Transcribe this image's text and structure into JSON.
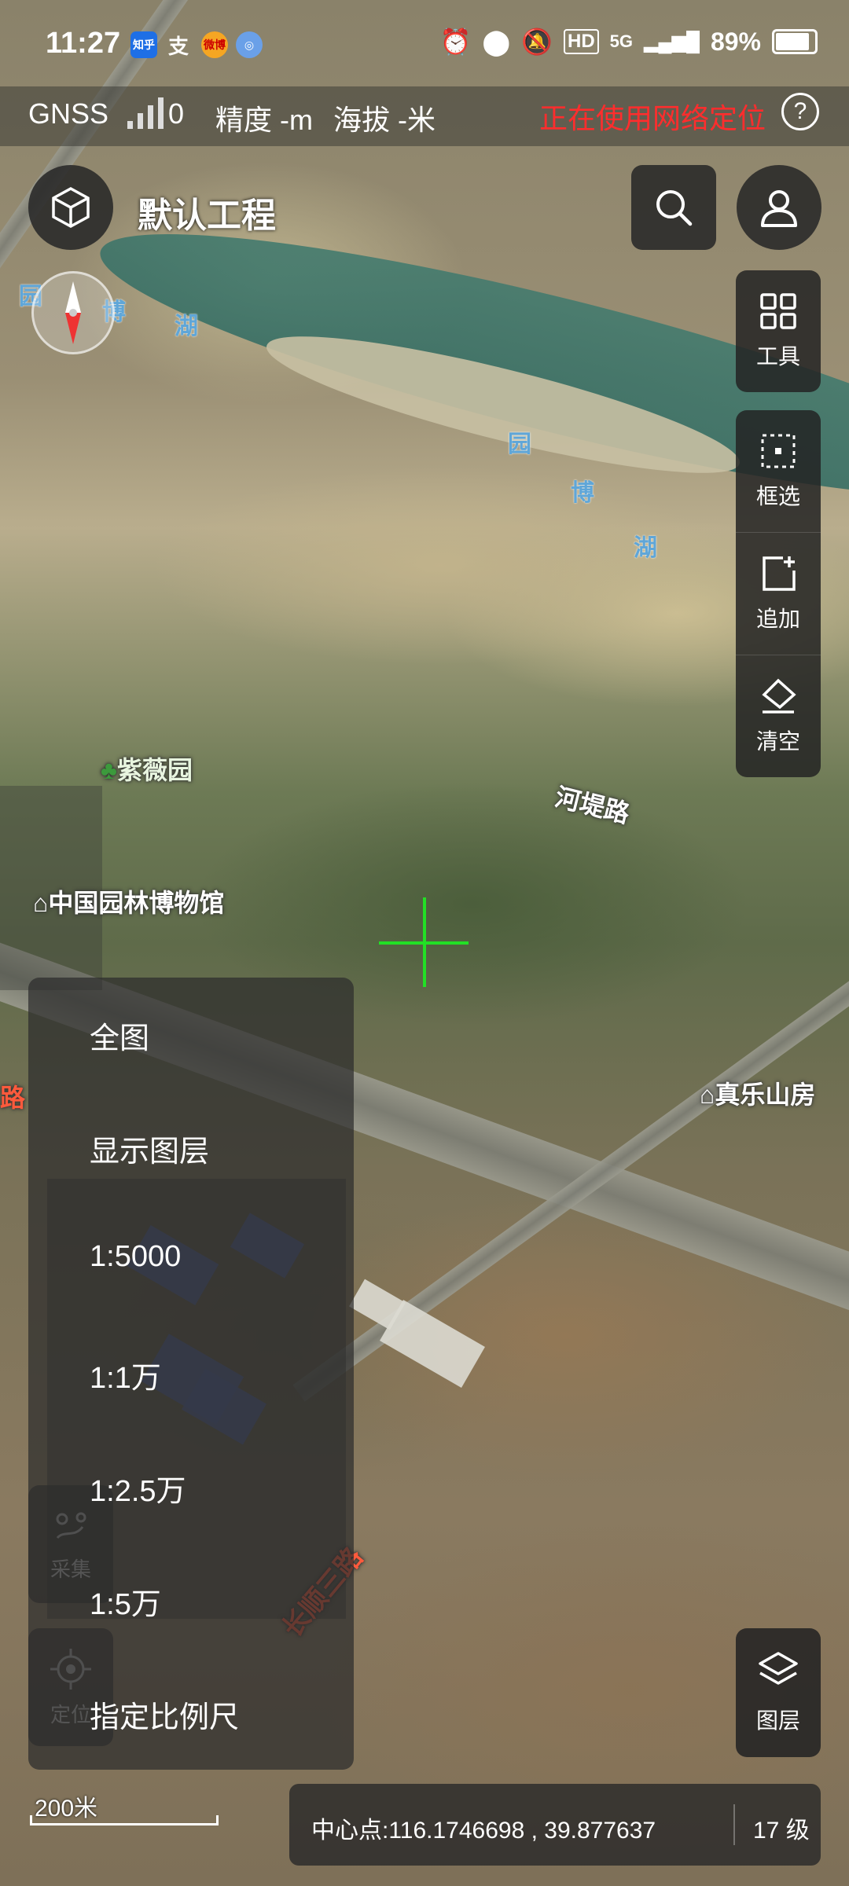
{
  "status_bar": {
    "time": "11:27",
    "apps": [
      "知乎",
      "支",
      "微博",
      "◎"
    ],
    "network": "5G",
    "battery": "89%"
  },
  "gnss_bar": {
    "label": "GNSS",
    "satellite_count": "0",
    "accuracy": "精度 -m",
    "altitude": "海拔 -米",
    "network_location": "正在使用网络定位",
    "help_symbol": "?"
  },
  "header": {
    "project_name": "默认工程"
  },
  "toolbar": {
    "tools_label": "工具",
    "select_label": "框选",
    "append_label": "追加",
    "clear_label": "清空"
  },
  "map_labels": {
    "lake1": "园",
    "lake2": "博",
    "lake3": "湖",
    "lake4": "园",
    "lake5": "博",
    "lake6": "湖",
    "ziwei": "紫薇园",
    "road": "河堤路",
    "museum": "中国园林博物馆",
    "zhenle": "真乐山房",
    "changshun": "长顺三路",
    "left_road": "路"
  },
  "scale_menu": {
    "items": [
      "全图",
      "显示图层",
      "1:5000",
      "1:1万",
      "1:2.5万",
      "1:5万",
      "指定比例尺"
    ]
  },
  "left_buttons": {
    "collect_label": "采集",
    "locate_label": "定位"
  },
  "layer_button_label": "图层",
  "scale_bar_label": "200米",
  "info_bar": {
    "center_point": "中心点:116.1746698 , 39.877637",
    "zoom_level": "17 级"
  },
  "colors": {
    "network_location_text": "#ff2d2d",
    "crosshair": "#22e025",
    "panel_bg": "#232323"
  }
}
